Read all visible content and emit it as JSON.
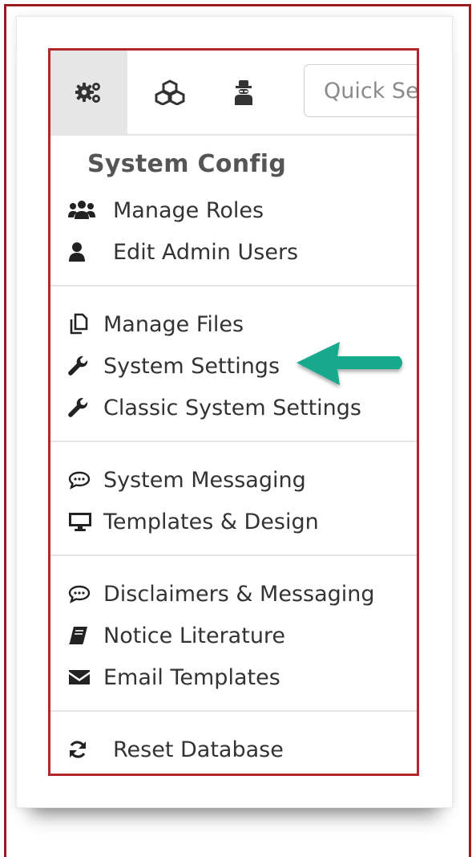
{
  "toolbar": {
    "quick_search_placeholder": "Quick Se"
  },
  "section_title": "System Config",
  "groups": [
    {
      "items": [
        {
          "label": "Manage Roles",
          "icon": "users-icon"
        },
        {
          "label": "Edit Admin Users",
          "icon": "user-icon"
        }
      ]
    },
    {
      "items": [
        {
          "label": "Manage Files",
          "icon": "files-icon"
        },
        {
          "label": "System Settings",
          "icon": "wrench-icon"
        },
        {
          "label": "Classic System Settings",
          "icon": "wrench-icon"
        }
      ]
    },
    {
      "items": [
        {
          "label": "System Messaging",
          "icon": "chat-bubble-icon"
        },
        {
          "label": "Templates & Design",
          "icon": "monitor-icon"
        }
      ]
    },
    {
      "items": [
        {
          "label": "Disclaimers & Messaging",
          "icon": "chat-bubble-icon"
        },
        {
          "label": "Notice Literature",
          "icon": "book-icon"
        },
        {
          "label": "Email Templates",
          "icon": "envelope-icon"
        }
      ]
    },
    {
      "items": [
        {
          "label": "Reset Database",
          "icon": "refresh-icon"
        }
      ]
    }
  ],
  "colors": {
    "border_red": "#b3262b",
    "frame_red": "#9b1c1c",
    "arrow_green": "#16a98b",
    "text": "#333333",
    "heading": "#555555",
    "active_tab": "#e6e6e6"
  }
}
